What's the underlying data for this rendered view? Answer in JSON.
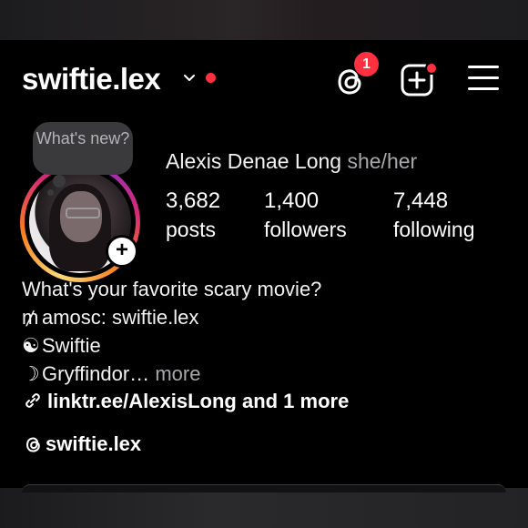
{
  "header": {
    "username": "swiftie.lex",
    "threads_badge_count": "1"
  },
  "note": {
    "text": "What's new?"
  },
  "profile": {
    "full_name": "Alexis Denae Long",
    "pronouns": "she/her",
    "stats": [
      {
        "value": "3,682",
        "label": "posts"
      },
      {
        "value": "1,400",
        "label": "followers"
      },
      {
        "value": "7,448",
        "label": "following"
      }
    ]
  },
  "bio": {
    "lines": [
      "What's your favorite scary movie?",
      "amosc: swiftie.lex",
      "Swiftie",
      "Gryffindor…"
    ],
    "line_glyphs": [
      "",
      "₥",
      "☯",
      "☽"
    ],
    "more_label": "more",
    "link_text": "linktr.ee/AlexisLong and 1 more",
    "threads_handle": "swiftie.lex"
  },
  "colors": {
    "accent_red": "#ff3040",
    "background": "#000000",
    "muted_text": "#a8a8ac"
  },
  "icons": [
    "chevron-down-icon",
    "threads-icon",
    "create-post-icon",
    "menu-icon",
    "link-icon",
    "add-story-icon"
  ]
}
